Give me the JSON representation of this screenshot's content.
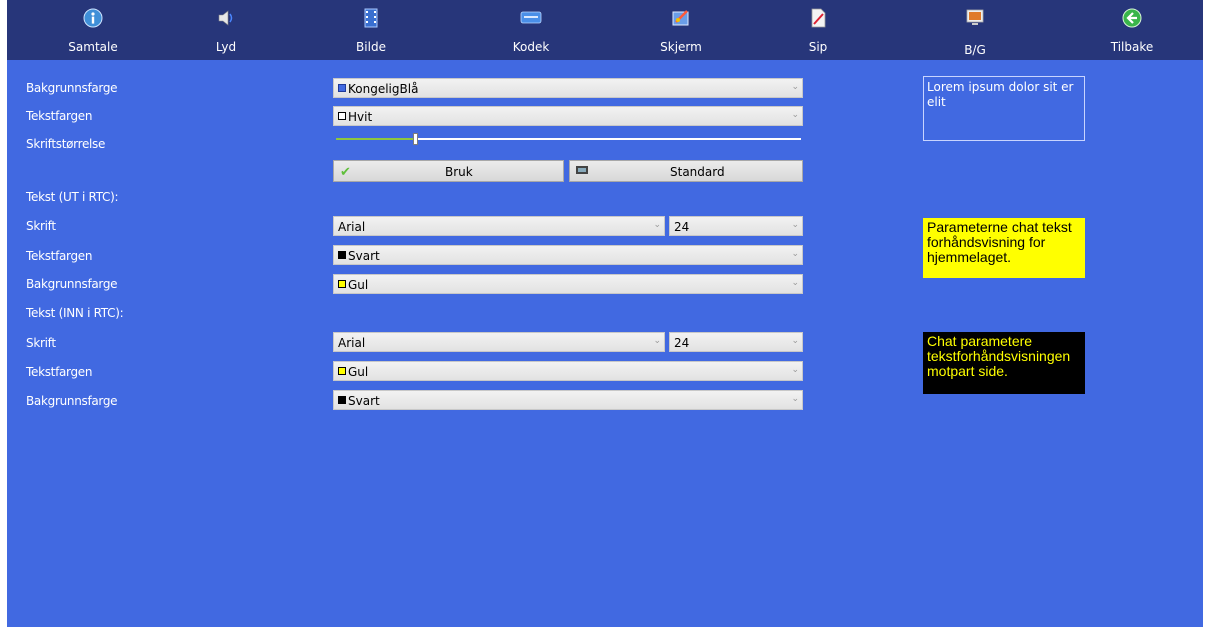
{
  "nav": {
    "items": [
      {
        "label": "Samtale",
        "icon": "info-icon"
      },
      {
        "label": "Lyd",
        "icon": "speaker-icon"
      },
      {
        "label": "Bilde",
        "icon": "film-icon"
      },
      {
        "label": "Kodek",
        "icon": "codec-icon"
      },
      {
        "label": "Skjerm",
        "icon": "paint-icon"
      },
      {
        "label": "Sip",
        "icon": "document-pen-icon"
      },
      {
        "label": "B/G",
        "icon": "monitor-icon"
      },
      {
        "label": "Tilbake",
        "icon": "back-arrow-icon"
      }
    ]
  },
  "general": {
    "bg_label": "Bakgrunnsfarge",
    "bg_value": "KongeligBlå",
    "bg_swatch": "#4169e1",
    "text_label": "Tekstfargen",
    "text_value": "Hvit",
    "text_swatch": "#ffffff",
    "size_label": "Skriftstørrelse",
    "size_level": 0.17,
    "apply_label": "Bruk",
    "default_label": "Standard",
    "preview": "Lorem ipsum dolor sit er elit"
  },
  "out_section": {
    "heading": "Tekst (UT i RTC):",
    "font_label": "Skrift",
    "font_value": "Arial",
    "size_value": "24",
    "text_label": "Tekstfargen",
    "text_value": "Svart",
    "text_swatch": "#000000",
    "bg_label": "Bakgrunnsfarge",
    "bg_value": "Gul",
    "bg_swatch": "#ffff00",
    "preview": "Parameterne chat tekst forhåndsvisning for hjemmelaget."
  },
  "in_section": {
    "heading": "Tekst (INN i RTC):",
    "font_label": "Skrift",
    "font_value": "Arial",
    "size_value": "24",
    "text_label": "Tekstfargen",
    "text_value": "Gul",
    "text_swatch": "#ffff00",
    "bg_label": "Bakgrunnsfarge",
    "bg_value": "Svart",
    "bg_swatch": "#000000",
    "preview": "Chat parametere tekstforhåndsvisningen motpart side."
  },
  "colors": {
    "background": "#4169e1",
    "topbar": "#27367a",
    "slider_fill": "#8dc63f"
  }
}
